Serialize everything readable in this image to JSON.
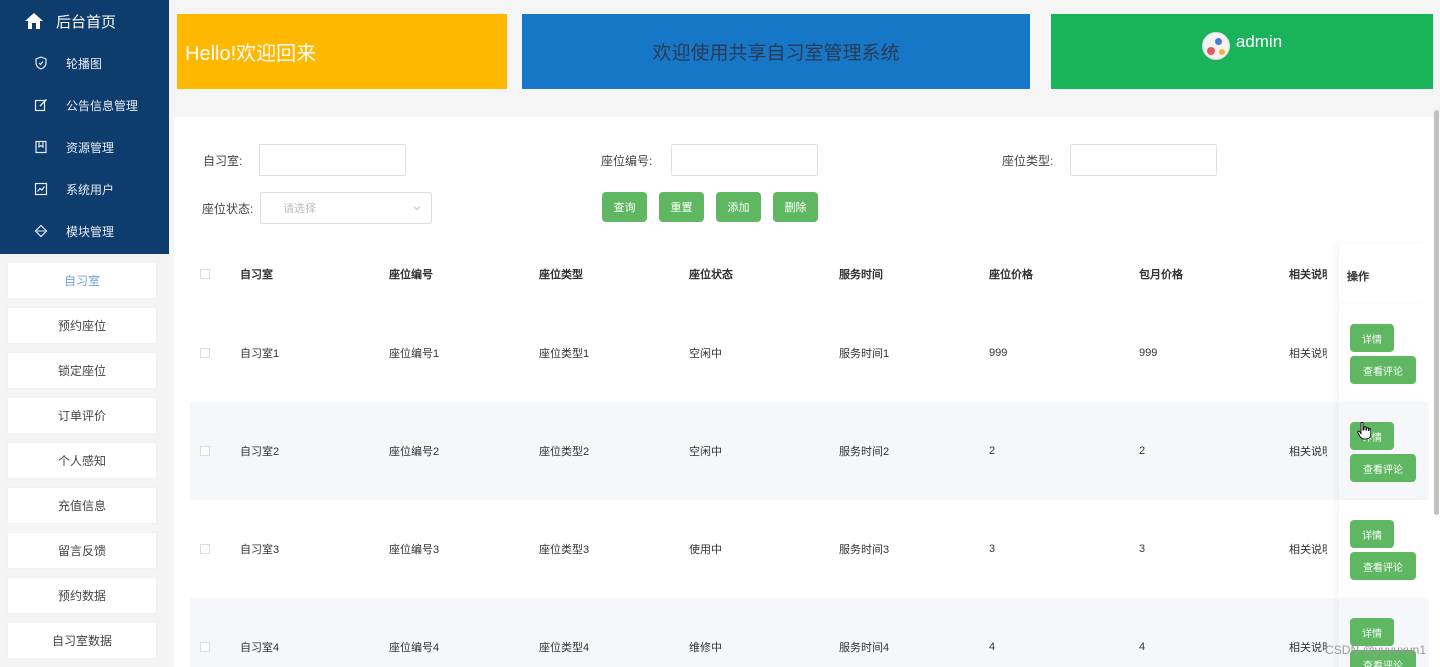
{
  "sidebar": {
    "home_label": "后台首页",
    "dark_items": [
      {
        "label": "轮播图",
        "icon": "shield-icon"
      },
      {
        "label": "公告信息管理",
        "icon": "edit-icon"
      },
      {
        "label": "资源管理",
        "icon": "bookmark-icon"
      },
      {
        "label": "系统用户",
        "icon": "chart-icon"
      },
      {
        "label": "模块管理",
        "icon": "diamond-icon"
      }
    ],
    "menu_items": [
      {
        "label": "自习室"
      },
      {
        "label": "预约座位"
      },
      {
        "label": "锁定座位"
      },
      {
        "label": "订单评价"
      },
      {
        "label": "个人感知"
      },
      {
        "label": "充值信息"
      },
      {
        "label": "留言反馈"
      },
      {
        "label": "预约数据"
      },
      {
        "label": "自习室数据"
      }
    ]
  },
  "cards": {
    "welcome": "Hello!欢迎回来",
    "system": "欢迎使用共享自习室管理系统",
    "user": "admin"
  },
  "colors": {
    "sidebar_dark": "#0e3c6c",
    "card_yellow": "#ffb800",
    "card_blue": "#1677c7",
    "card_green": "#19b35a",
    "button_green": "#5fb861"
  },
  "search": {
    "room_label": "自习室:",
    "seat_no_label": "座位编号:",
    "seat_type_label": "座位类型:",
    "seat_status_label": "座位状态:",
    "seat_status_placeholder": "请选择",
    "buttons": {
      "query": "查询",
      "reset": "重置",
      "add": "添加",
      "delete": "删除"
    }
  },
  "table": {
    "headers": [
      "自习室",
      "座位编号",
      "座位类型",
      "座位状态",
      "服务时间",
      "座位价格",
      "包月价格",
      "相关说明",
      "操作"
    ],
    "rows": [
      {
        "room": "自习室1",
        "seat_no": "座位编号1",
        "seat_type": "座位类型1",
        "status": "空闲中",
        "time": "服务时间1",
        "price": "999",
        "monthly": "999",
        "note": "相关说明"
      },
      {
        "room": "自习室2",
        "seat_no": "座位编号2",
        "seat_type": "座位类型2",
        "status": "空闲中",
        "time": "服务时间2",
        "price": "2",
        "monthly": "2",
        "note": "相关说明"
      },
      {
        "room": "自习室3",
        "seat_no": "座位编号3",
        "seat_type": "座位类型3",
        "status": "使用中",
        "time": "服务时间3",
        "price": "3",
        "monthly": "3",
        "note": "相关说明"
      },
      {
        "room": "自习室4",
        "seat_no": "座位编号4",
        "seat_type": "座位类型4",
        "status": "维修中",
        "time": "服务时间4",
        "price": "4",
        "monthly": "4",
        "note": "相关说明"
      }
    ],
    "op_detail": "详情",
    "op_comments": "查看评论"
  },
  "watermark": "CSDN @yuyuxun1"
}
